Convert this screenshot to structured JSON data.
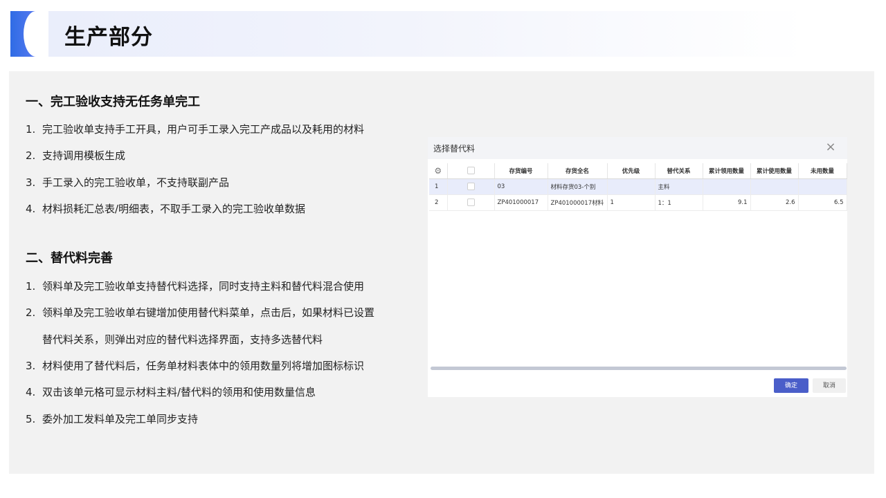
{
  "slide": {
    "title": "生产部分"
  },
  "section1": {
    "heading": "一、完工验收支持无任务单完工",
    "items": [
      {
        "num": "1.",
        "text": "完工验收单支持手工开具，用户可手工录入完工产成品以及耗用的材料"
      },
      {
        "num": "2.",
        "text": "支持调用模板生成"
      },
      {
        "num": "3.",
        "text": "手工录入的完工验收单，不支持联副产品"
      },
      {
        "num": "4.",
        "text": "材料损耗汇总表/明细表，不取手工录入的完工验收单数据"
      }
    ]
  },
  "section2": {
    "heading": "二、替代料完善",
    "items": [
      {
        "num": "1.",
        "text": "领料单及完工验收单支持替代料选择，同时支持主料和替代料混合使用"
      },
      {
        "num": "2.",
        "text": "领料单及完工验收单右键增加使用替代料菜单，点击后，如果材料已设置"
      },
      {
        "num": "",
        "text": "替代料关系，则弹出对应的替代料选择界面，支持多选替代料"
      },
      {
        "num": "3.",
        "text": "材料使用了替代料后，任务单材料表体中的领用数量列将增加图标标识"
      },
      {
        "num": "4.",
        "text": "双击该单元格可显示材料主料/替代料的领用和使用数量信息"
      },
      {
        "num": "5.",
        "text": "委外加工发料单及完工单同步支持"
      }
    ]
  },
  "dialog": {
    "title": "选择替代料",
    "close_icon": "×",
    "gear_icon": "⚙",
    "columns": [
      "存货编号",
      "存货全名",
      "优先级",
      "替代关系",
      "累计领用数量",
      "累计使用数量",
      "未用数量"
    ],
    "rows": [
      {
        "idx": "1",
        "code": "03",
        "name": "材料存货03-个别",
        "priority": "",
        "relation": "主料",
        "issued": "",
        "used": "",
        "unused": ""
      },
      {
        "idx": "2",
        "code": "ZP401000017",
        "name": "ZP401000017材料",
        "priority": "1",
        "relation": "1：1",
        "issued": "9.1",
        "used": "2.6",
        "unused": "6.5"
      }
    ],
    "ok_label": "确定",
    "cancel_label": "取消"
  }
}
